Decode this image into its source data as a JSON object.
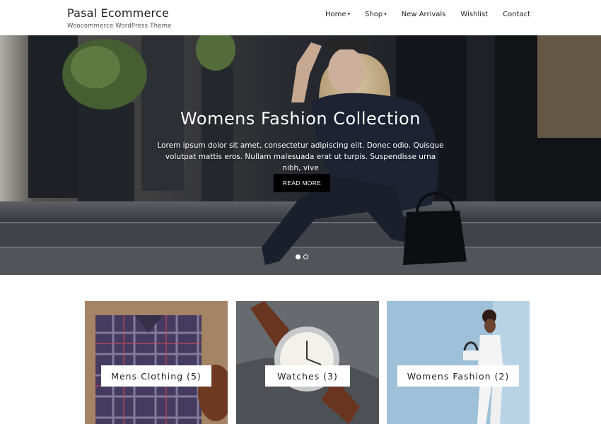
{
  "header": {
    "site_title": "Pasal Ecommerce",
    "site_tagline": "Woocommerce WordPress Theme",
    "nav": [
      {
        "label": "Home",
        "has_dropdown": true
      },
      {
        "label": "Shop",
        "has_dropdown": true
      },
      {
        "label": "New Arrivals",
        "has_dropdown": false
      },
      {
        "label": "Wishlist",
        "has_dropdown": false
      },
      {
        "label": "Contact",
        "has_dropdown": false
      }
    ]
  },
  "hero": {
    "title": "Womens Fashion Collection",
    "text": "Lorem ipsum dolor sit amet, consectetur adipiscing elit. Donec odio. Quisque volutpat mattis eros. Nullam malesuada erat ut turpis. Suspendisse urna nibh, vive",
    "button": "READ MORE",
    "slides_total": 2,
    "slide_active": 1
  },
  "categories": [
    {
      "label": "Mens Clothing  (5)"
    },
    {
      "label": "Watches  (3)"
    },
    {
      "label": "Womens Fashion  (2)"
    }
  ],
  "icons": {
    "caret": "caret-down-icon"
  },
  "colors": {
    "header_bg": "#ffffff",
    "hero_overlay": "#3a3d44",
    "button_bg": "#000000",
    "text": "#222222"
  }
}
